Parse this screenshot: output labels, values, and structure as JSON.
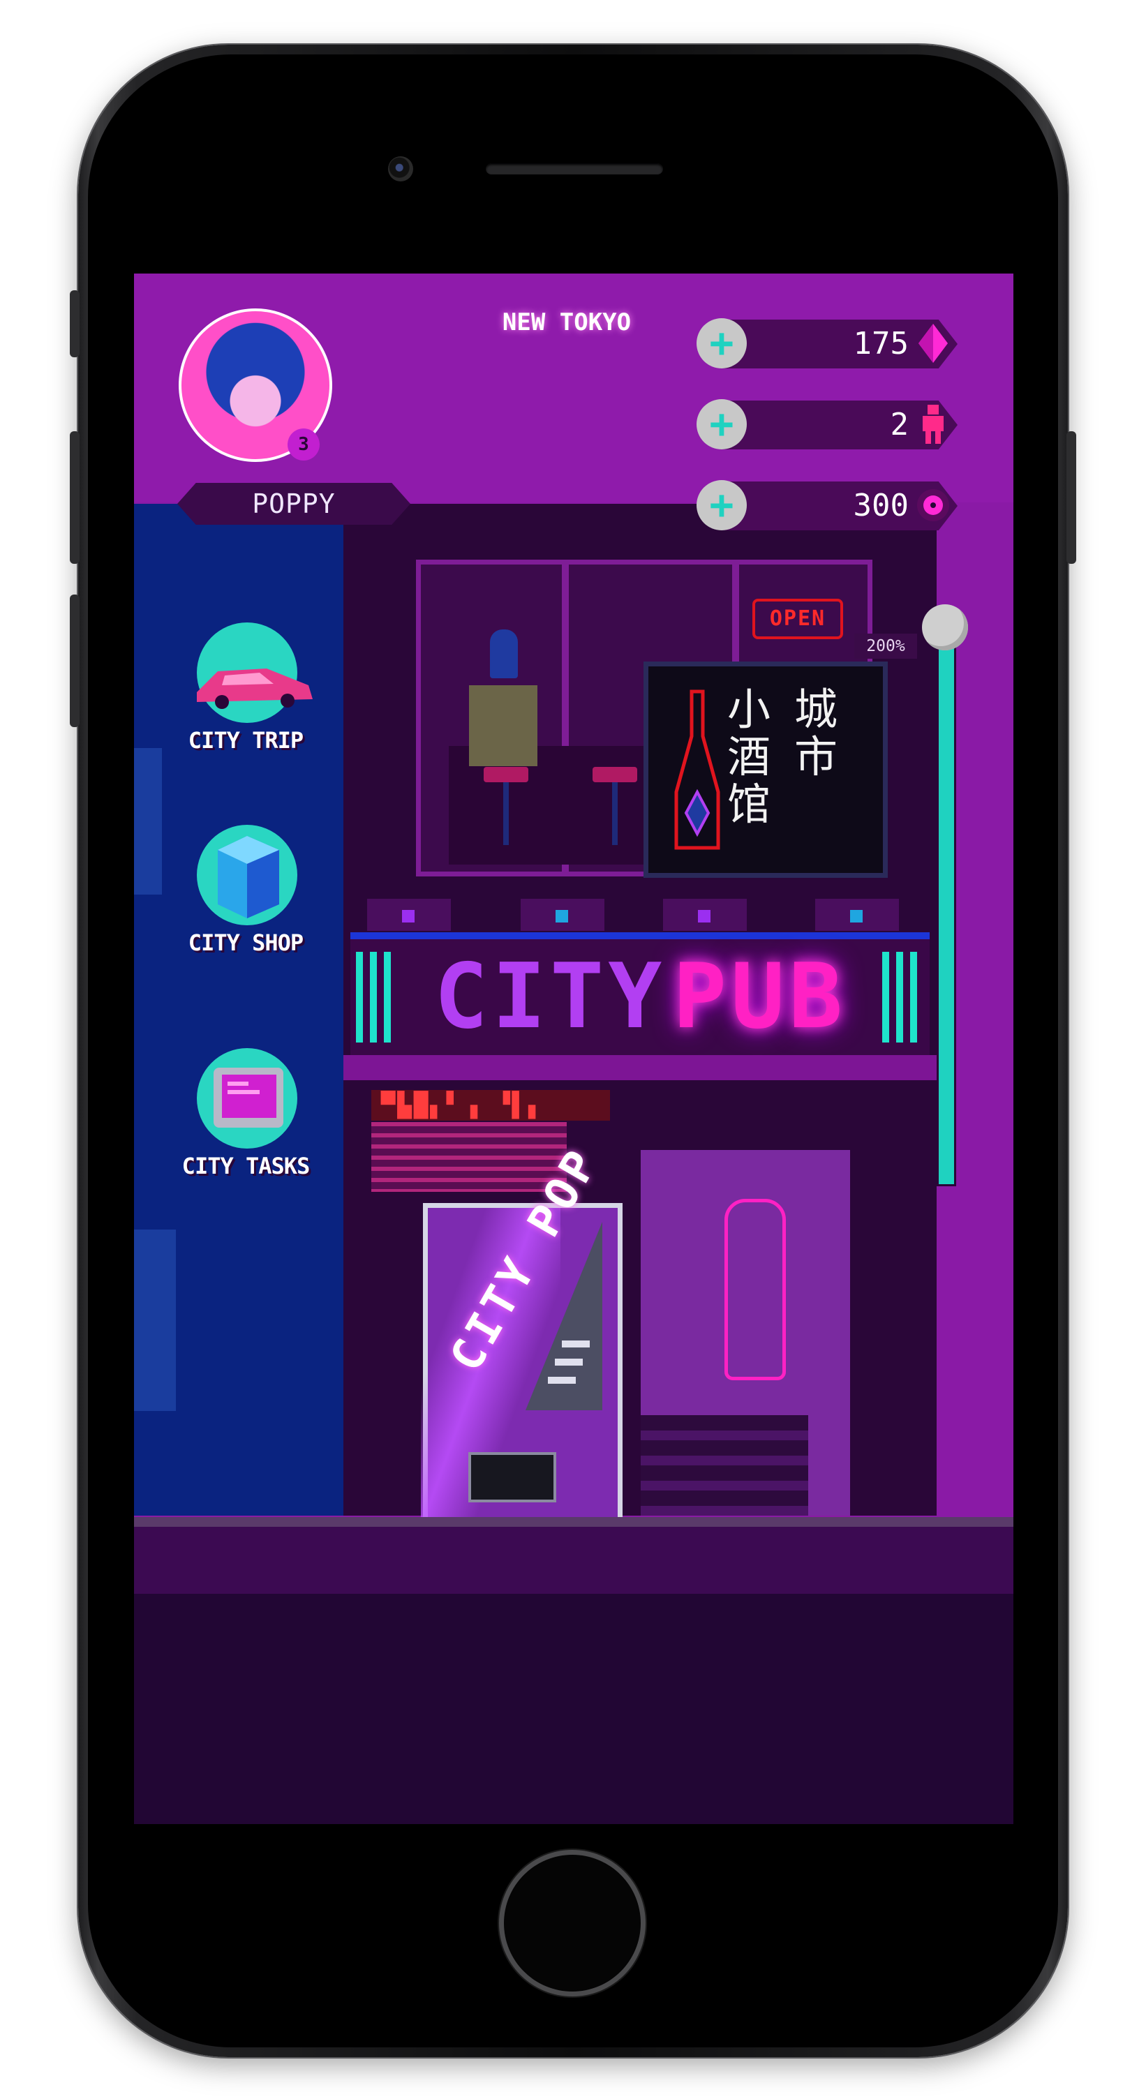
{
  "hud": {
    "player_name": "POPPY",
    "level": "3",
    "city_name": "NEW TOKYO",
    "resources": [
      {
        "value": "175",
        "icon": "gem-icon",
        "plus": "+"
      },
      {
        "value": "2",
        "icon": "person-icon",
        "plus": "+"
      },
      {
        "value": "300",
        "icon": "vinyl-record-icon",
        "plus": "+"
      }
    ]
  },
  "menu": {
    "items": [
      {
        "label": "CITY TRIP",
        "icon": "sports-car-icon"
      },
      {
        "label": "CITY SHOP",
        "icon": "building-cube-icon"
      },
      {
        "label": "CITY TASKS",
        "icon": "monitor-icon"
      }
    ]
  },
  "scene": {
    "open_sign": "OPEN",
    "chinese_sign": {
      "col1": "城市",
      "col2": "小酒馆"
    },
    "pub_sign": {
      "part1": "CITY",
      "part2": "PUB"
    },
    "vending_text": "CITY POP",
    "zoom_label": "200%"
  },
  "zoom": {
    "level_percent": 200
  },
  "colors": {
    "sky_purple": "#8f1bab",
    "teal": "#1fd2c0",
    "neon_pink": "#ff21c4",
    "neon_violet": "#b23ff2",
    "blue_building": "#0a2380"
  }
}
